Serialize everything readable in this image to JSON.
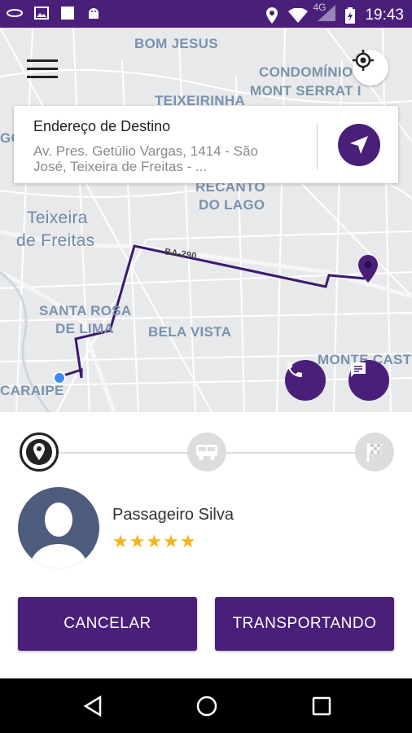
{
  "status_bar": {
    "time": "19:43",
    "network": "4G",
    "icons": [
      "carrier-icon",
      "image-icon",
      "square-icon",
      "android-icon",
      "location-icon",
      "wifi-icon",
      "signal-icon",
      "battery-icon"
    ]
  },
  "map": {
    "labels": {
      "bom_jesus": "BOM JESUS",
      "condominio": "CONDOMÍNIO",
      "mont_serrat": "MONT SERRAT I",
      "teixeirinha": "TEIXEIRINHA",
      "go": "GO",
      "recanto": "RECANTO",
      "do_lago": "DO LAGO",
      "teixeira": "Teixeira",
      "de_freitas": "de Freitas",
      "ba_290": "BA-290",
      "santa_rosa": "SANTA ROSA",
      "de_lima": "DE LIMA",
      "bela_vista": "BELA VISTA",
      "monte_castelo": "MONTE CASTE",
      "caraipe": "CARAIPE"
    },
    "route_color": "#3b1a6e",
    "pin_color": "#4a1f7a"
  },
  "destination": {
    "title": "Endereço de Destino",
    "address": "Av. Pres. Getúlio Vargas, 1414 - São José, Teixeira de Freitas - ..."
  },
  "progress": {
    "steps": [
      "pickup-pin",
      "bus",
      "finish-flag"
    ],
    "active_step": 0
  },
  "passenger": {
    "name": "Passageiro Silva",
    "stars": "★★★★★",
    "rating": 5
  },
  "buttons": {
    "cancel": "CANCELAR",
    "transporting": "TRANSPORTANDO"
  },
  "colors": {
    "primary": "#4a1f7a",
    "star": "#f6b21b"
  }
}
